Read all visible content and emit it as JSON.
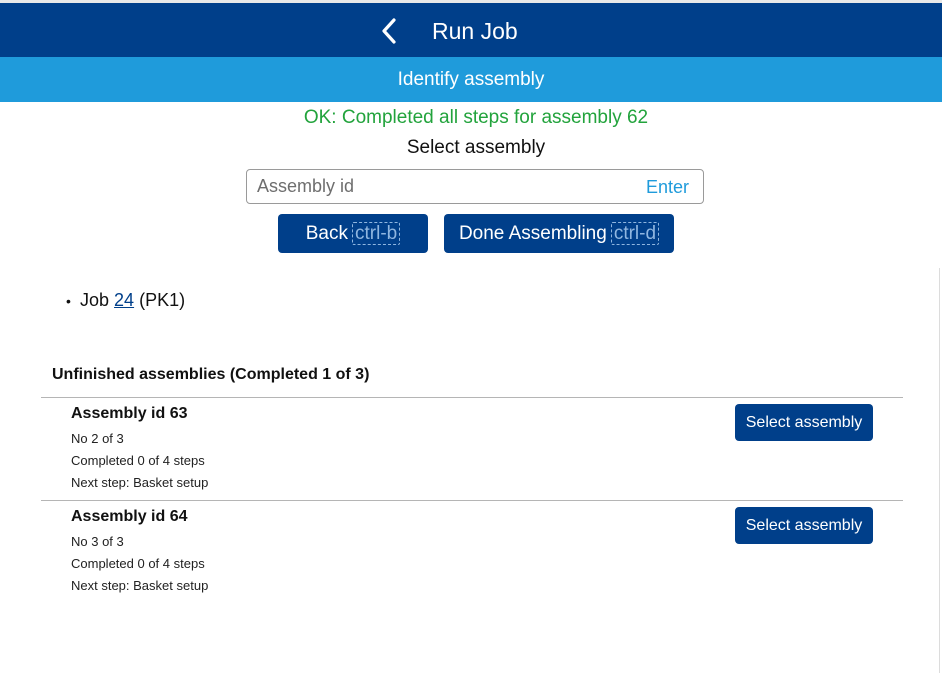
{
  "header": {
    "title": "Run Job",
    "back_icon": "chevron-left-icon"
  },
  "subheader": {
    "title": "Identify assembly"
  },
  "status": {
    "message": "OK: Completed all steps for assembly 62",
    "color": "#22a33c"
  },
  "select": {
    "label": "Select assembly",
    "input_placeholder": "Assembly id",
    "input_value": "",
    "enter_hint": "Enter"
  },
  "actions": {
    "back_label": "Back",
    "back_shortcut": "ctrl-b",
    "done_label": "Done Assembling",
    "done_shortcut": "ctrl-d"
  },
  "job": {
    "prefix": "Job",
    "id": "24",
    "suffix": "(PK1)"
  },
  "unfinished": {
    "title": "Unfinished assemblies (Completed 1 of 3)",
    "items": [
      {
        "title": "Assembly id 63",
        "position": "No 2 of 3",
        "progress": "Completed 0 of 4 steps",
        "next_step": "Next step: Basket setup",
        "button": "Select assembly"
      },
      {
        "title": "Assembly id 64",
        "position": "No 3 of 3",
        "progress": "Completed 0 of 4 steps",
        "next_step": "Next step: Basket setup",
        "button": "Select assembly"
      }
    ]
  },
  "colors": {
    "header": "#003f8a",
    "subheader": "#1f9bdb",
    "button": "#003f8a",
    "success": "#22a33c"
  }
}
